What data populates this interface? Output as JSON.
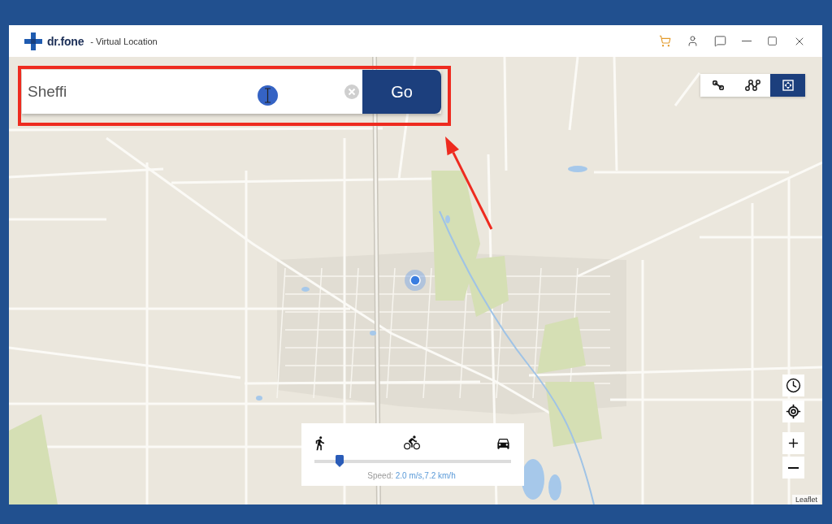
{
  "window": {
    "logo": "dr.fone",
    "subtitle": "- Virtual Location"
  },
  "search": {
    "value": "Sheffi",
    "button": "Go"
  },
  "mode_buttons": [
    {
      "kind": "one_stop",
      "selected": false
    },
    {
      "kind": "multi_stop",
      "selected": false
    },
    {
      "kind": "teleport",
      "selected": true
    }
  ],
  "speed": {
    "modes": [
      {
        "kind": "walk"
      },
      {
        "kind": "bike"
      },
      {
        "kind": "car"
      }
    ],
    "level": 0.13,
    "label": "Speed:",
    "reading": "2.0 m/s,7.2 km/h"
  },
  "attribution": "Leaflet"
}
